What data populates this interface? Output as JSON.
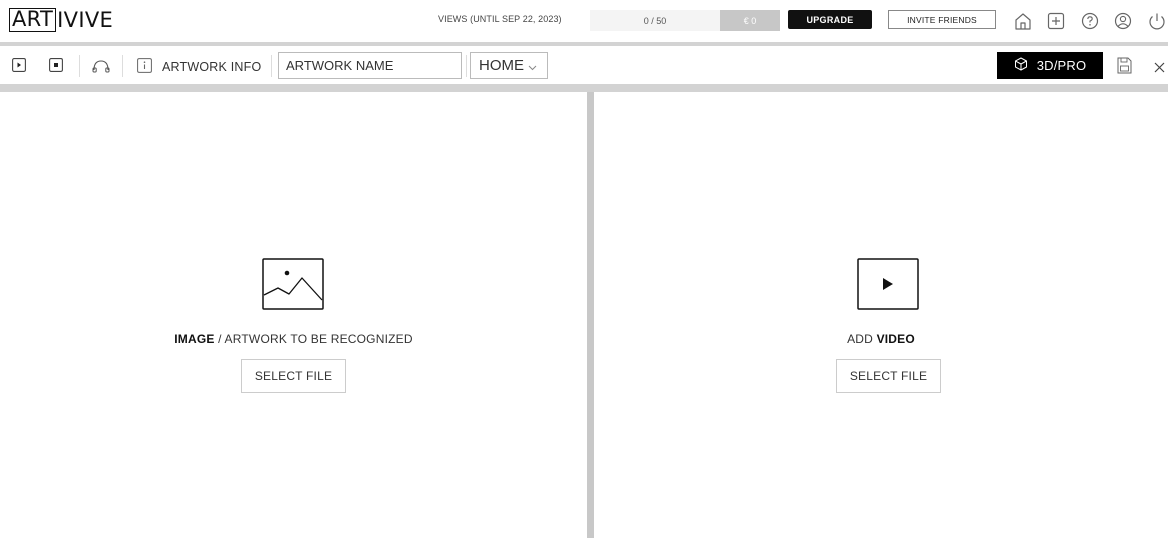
{
  "header": {
    "logo_boxed": "ART",
    "logo_rest": "IVIVE",
    "views_label": "VIEWS (UNTIL SEP 22, 2023)",
    "views_value": "0 / 50",
    "balance": "€ 0",
    "upgrade_label": "UPGRADE",
    "invite_label": "INVITE FRIENDS",
    "icons": [
      "home-icon",
      "plus-icon",
      "help-icon",
      "account-icon",
      "power-icon"
    ]
  },
  "toolbar": {
    "icons": [
      "play-icon",
      "stop-icon",
      "headphones-icon",
      "info-icon"
    ],
    "artwork_info_label": "ARTWORK INFO",
    "artwork_name_value": "ARTWORK NAME",
    "home_select_value": "HOME",
    "pro_label": "3D/PRO",
    "save_icon": "save-icon",
    "close_icon": "close-icon"
  },
  "left_pane": {
    "caption_bold": "IMAGE",
    "caption_rest": " / ARTWORK TO BE RECOGNIZED",
    "button_label": "SELECT FILE",
    "icon": "image-icon"
  },
  "right_pane": {
    "caption_rest": "ADD ",
    "caption_bold": "VIDEO",
    "button_label": "SELECT FILE",
    "icon": "video-play-icon"
  },
  "colors": {
    "accent": "#000000",
    "divider": "#d3d3d3",
    "pane_divider": "#c8c8c8",
    "balance_bg": "#c7c7c7",
    "meter_bg": "#f4f4f4"
  }
}
